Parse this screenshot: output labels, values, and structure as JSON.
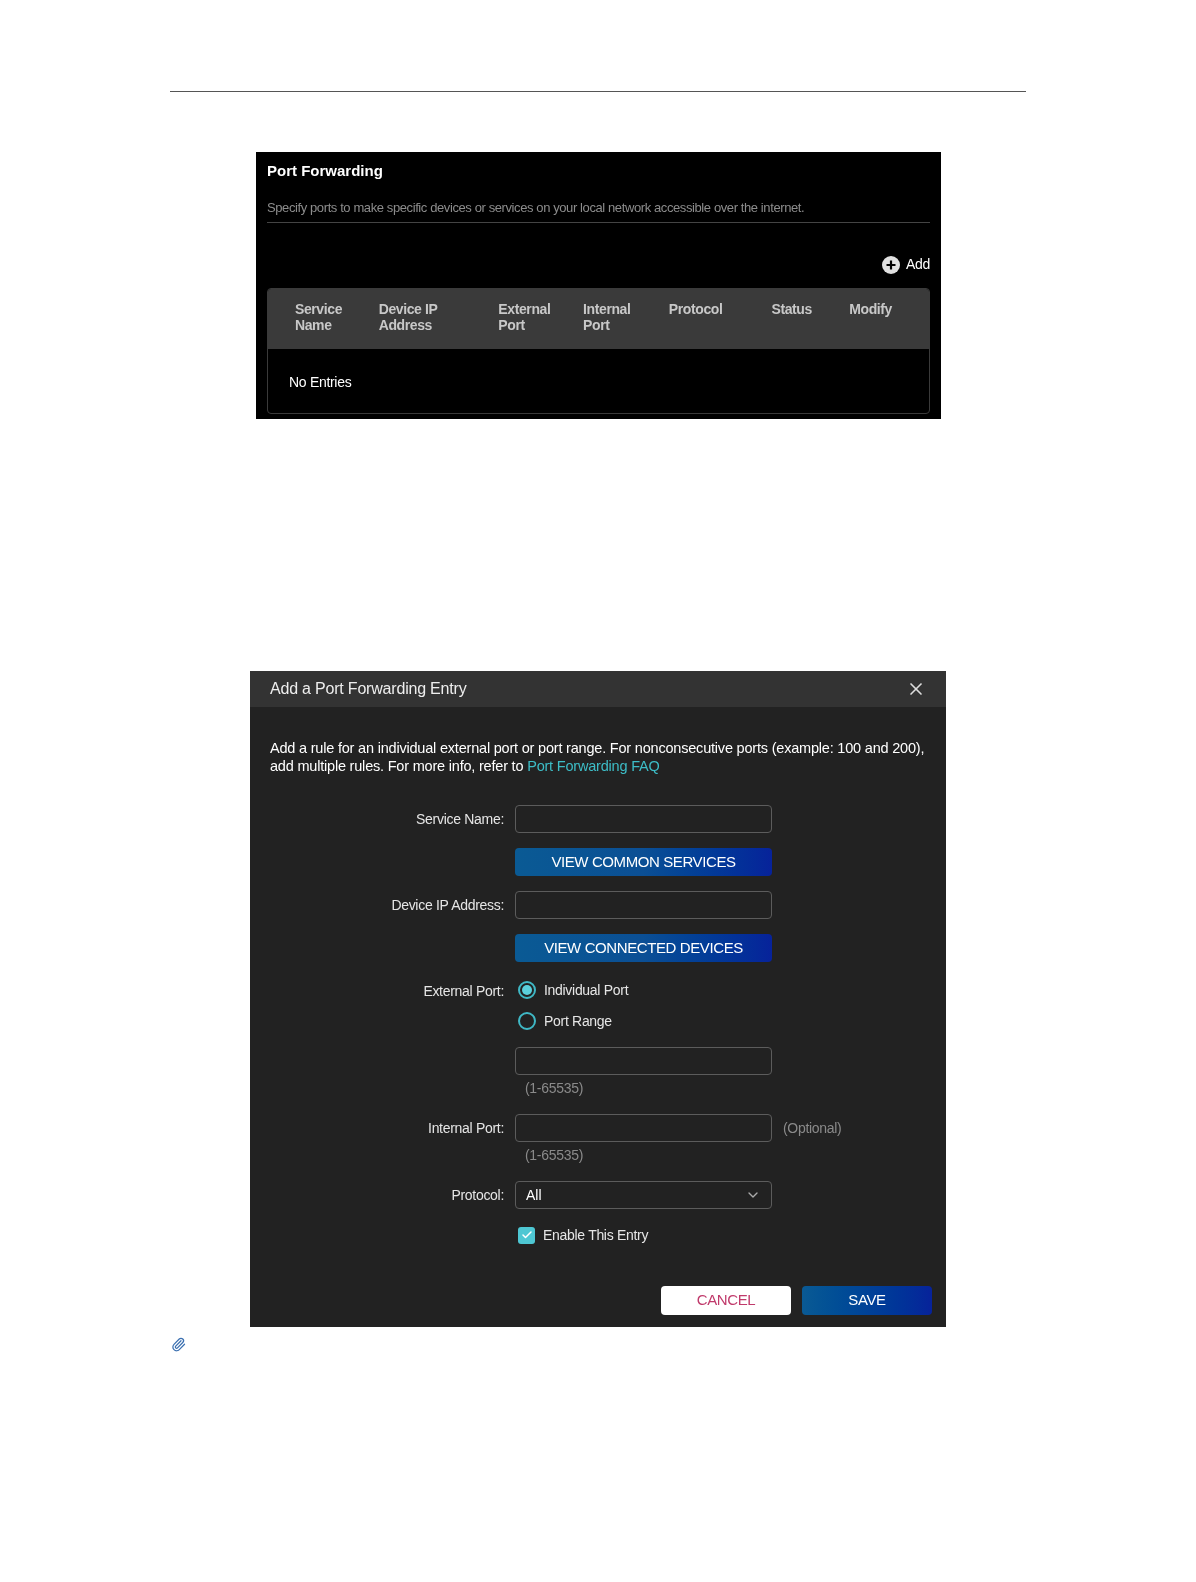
{
  "panel": {
    "title": "Port Forwarding",
    "description": "Specify ports to make specific devices or services on your local network accessible over the internet.",
    "add_label": "Add",
    "table": {
      "columns": [
        [
          "Service",
          "Name"
        ],
        [
          "Device IP",
          "Address"
        ],
        [
          "External",
          "Port"
        ],
        [
          "Internal",
          "Port"
        ],
        [
          "Protocol"
        ],
        [
          "Status"
        ],
        [
          "Modify"
        ]
      ],
      "empty_text": "No Entries"
    }
  },
  "dialog": {
    "title": "Add a Port Forwarding Entry",
    "description": "Add a rule for an individual external port or port range. For nonconsecutive ports (example: 100 and 200), add multiple rules. For more info, refer to ",
    "link": "Port Forwarding FAQ",
    "rows": [
      {
        "kind": "input",
        "label": "Service Name:"
      },
      {
        "kind": "action",
        "label": "VIEW COMMON SERVICES"
      },
      {
        "kind": "input",
        "label": "Device IP Address:"
      },
      {
        "kind": "action",
        "label": "VIEW CONNECTED DEVICES"
      },
      {
        "kind": "radio",
        "label": "External Port:",
        "options": [
          {
            "label": "Individual Port",
            "selected": true
          },
          {
            "label": "Port Range",
            "selected": false
          }
        ]
      },
      {
        "kind": "input",
        "hint": "(1-65535)"
      },
      {
        "kind": "input",
        "label": "Internal Port:",
        "suffix": "(Optional)",
        "hint": "(1-65535)"
      },
      {
        "kind": "select",
        "label": "Protocol:",
        "value": "All"
      },
      {
        "kind": "checkbox",
        "label": "Enable This Entry",
        "checked": true
      }
    ],
    "buttons": [
      {
        "kind": "cancel",
        "label": "CANCEL"
      },
      {
        "kind": "save",
        "label": "SAVE"
      }
    ]
  }
}
